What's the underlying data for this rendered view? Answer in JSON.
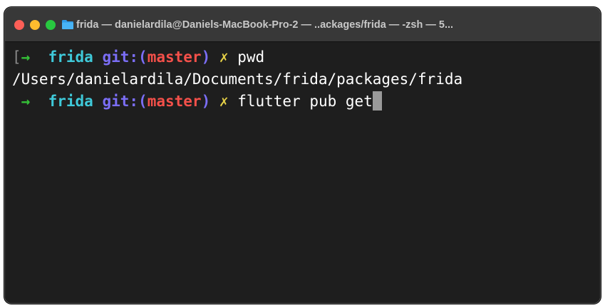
{
  "window": {
    "title": "frida — danielardila@Daniels-MacBook-Pro-2 — ..ackages/frida — -zsh — 5..."
  },
  "colors": {
    "close": "#fe5f57",
    "minimize": "#febc2e",
    "maximize": "#28c840",
    "arrow": "#35c238",
    "directory": "#3fc9d9",
    "git": "#7b6ef6",
    "branch": "#f4504a",
    "dirty": "#e5d047",
    "background": "#1e1e1e"
  },
  "terminal": {
    "lines": [
      {
        "arrow": "→",
        "dir": "frida",
        "git_open": "git:(",
        "branch": "master",
        "git_close": ")",
        "dirty": "✗",
        "command": "pwd"
      },
      {
        "output": "/Users/danielardila/Documents/frida/packages/frida"
      },
      {
        "arrow": "→",
        "dir": "frida",
        "git_open": "git:(",
        "branch": "master",
        "git_close": ")",
        "dirty": "✗",
        "command": "flutter pub get"
      }
    ]
  }
}
